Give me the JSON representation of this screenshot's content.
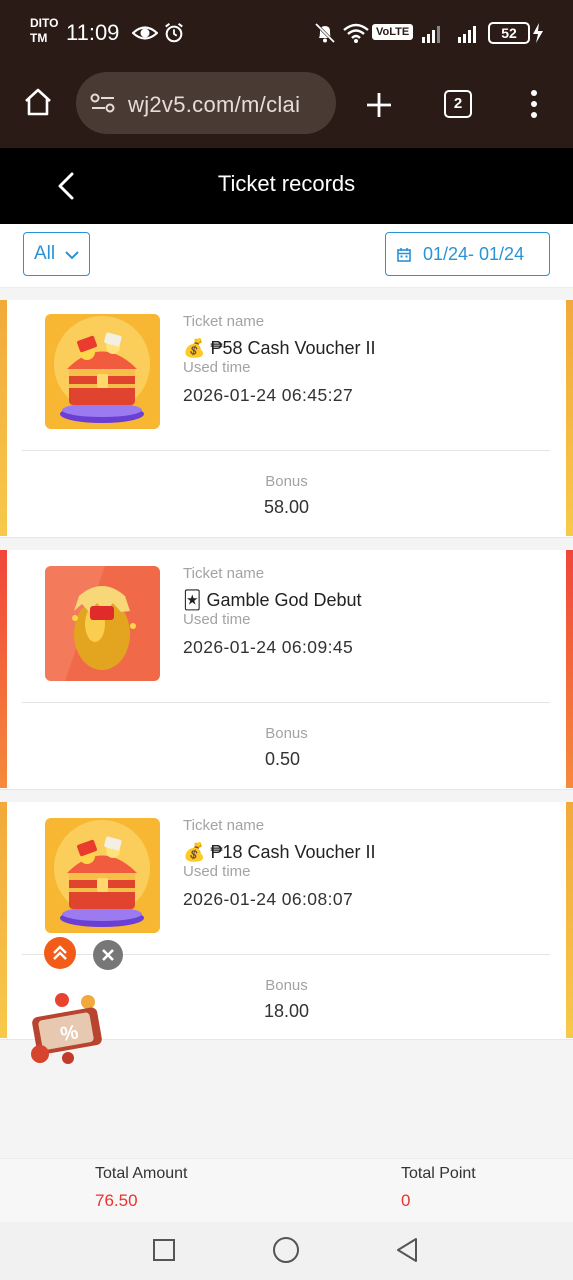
{
  "status_bar": {
    "carrier_line1": "DITO",
    "carrier_line2": "TM",
    "time": "11:09",
    "volte_label": "VoLTE",
    "battery": "52"
  },
  "browser": {
    "url": "wj2v5.com/m/clai",
    "tab_count": "2"
  },
  "header": {
    "title": "Ticket records"
  },
  "filters": {
    "type_selected": "All",
    "date_range": "01/24- 01/24"
  },
  "labels": {
    "ticket_name": "Ticket name",
    "used_time": "Used time",
    "bonus": "Bonus"
  },
  "records": [
    {
      "emoji": "💰",
      "name": "₱58 Cash Voucher II",
      "used_time": "2026-01-24 06:45:27",
      "bonus": "58.00",
      "accent": "#f2a93b",
      "image": "treasure-chest"
    },
    {
      "emoji": "🃏",
      "name": "Gamble God Debut",
      "used_time": "2026-01-24 06:09:45",
      "bonus": "0.50",
      "accent": "#f0463a",
      "image": "golden-egg"
    },
    {
      "emoji": "💰",
      "name": "₱18 Cash Voucher II",
      "used_time": "2026-01-24 06:08:07",
      "bonus": "18.00",
      "accent": "#f2a93b",
      "image": "treasure-chest"
    }
  ],
  "footer": {
    "total_amount_label": "Total Amount",
    "total_amount": "76.50",
    "total_point_label": "Total Point",
    "total_point": "0"
  },
  "colors": {
    "chrome_bg": "#2a1b17",
    "header_bg": "#000000",
    "accent_blue": "#2a93d5",
    "total_red": "#e8332f"
  }
}
